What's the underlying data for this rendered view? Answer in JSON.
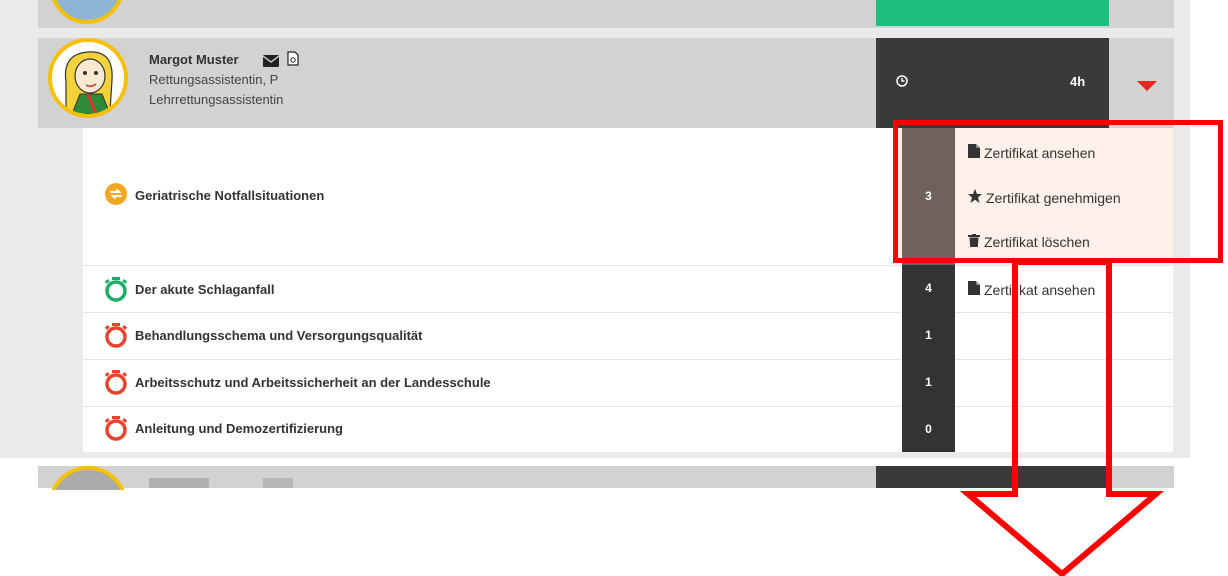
{
  "person": {
    "name": "Margot Muster",
    "role_line1": "Rettungsassistentin, P",
    "role_line2": "Lehrrettungsassistentin",
    "hours": "4h"
  },
  "courses": [
    {
      "title": "Geriatrische Notfallsituationen",
      "count": "3",
      "status": "in-progress"
    },
    {
      "title": "Der akute Schlaganfall",
      "count": "4",
      "status": "done"
    },
    {
      "title": "Behandlungsschema und Versorgungsqualität",
      "count": "1",
      "status": "open"
    },
    {
      "title": "Arbeitsschutz und Arbeitssicherheit an der Landesschule",
      "count": "1",
      "status": "open"
    },
    {
      "title": "Anleitung und Demozertifizierung",
      "count": "0",
      "status": "open"
    }
  ],
  "actions": {
    "view": "Zertifikat ansehen",
    "approve": "Zertifikat genehmigen",
    "delete": "Zertifikat löschen"
  },
  "row2_action": "Zertifikat ansehen",
  "colors": {
    "accent_green": "#1dbf7f",
    "dark_cell": "#3a3a3a",
    "highlight_red": "#ff0000",
    "avatar_ring": "#f5c000",
    "caret_red": "#e8261d"
  },
  "icons": [
    "mail-icon",
    "pdf-icon",
    "clock-icon",
    "caret-down-icon",
    "sync-icon",
    "stopwatch-icon",
    "file-icon",
    "star-icon",
    "trash-icon"
  ]
}
